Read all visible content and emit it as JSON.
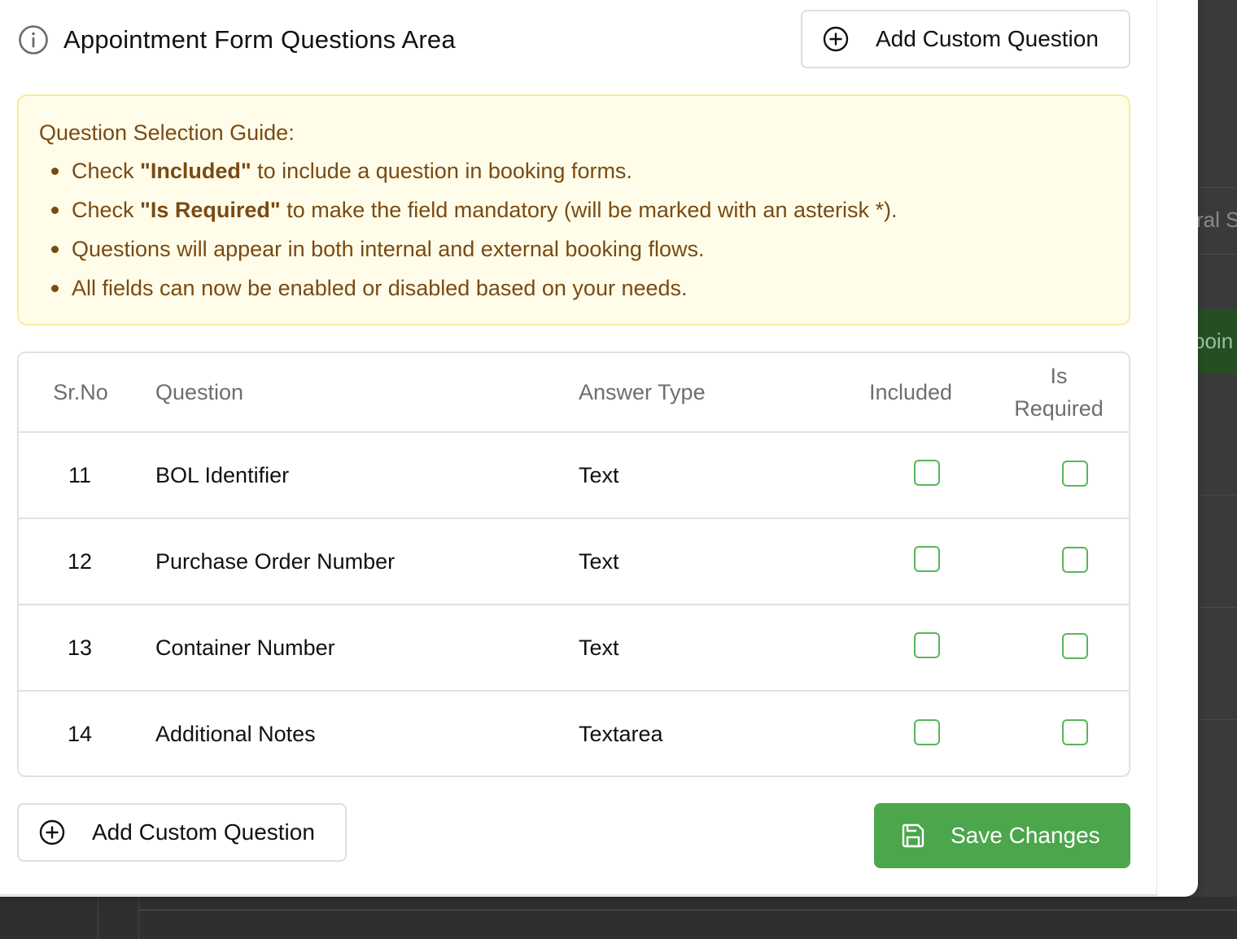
{
  "header": {
    "title": "Appointment Form Questions Area",
    "add_button_label": "Add Custom Question"
  },
  "guide": {
    "title": "Question Selection Guide:",
    "items": [
      {
        "prefix": "Check ",
        "bold": "\"Included\"",
        "suffix": " to include a question in booking forms."
      },
      {
        "prefix": "Check ",
        "bold": "\"Is Required\"",
        "suffix": " to make the field mandatory (will be marked with an asterisk *)."
      },
      {
        "prefix": "Questions will appear in both internal and external booking flows.",
        "bold": "",
        "suffix": ""
      },
      {
        "prefix": "All fields can now be enabled or disabled based on your needs.",
        "bold": "",
        "suffix": ""
      }
    ]
  },
  "table": {
    "columns": {
      "sr": "Sr.No",
      "question": "Question",
      "type": "Answer Type",
      "included": "Included",
      "required_line1": "Is",
      "required_line2": "Required"
    },
    "rows": [
      {
        "sr": "11",
        "question": "BOL Identifier",
        "type": "Text",
        "included": false,
        "required": false
      },
      {
        "sr": "12",
        "question": "Purchase Order Number",
        "type": "Text",
        "included": false,
        "required": false
      },
      {
        "sr": "13",
        "question": "Container Number",
        "type": "Text",
        "included": false,
        "required": false
      },
      {
        "sr": "14",
        "question": "Additional Notes",
        "type": "Textarea",
        "included": false,
        "required": false
      }
    ]
  },
  "footer": {
    "add_button_label": "Add Custom Question",
    "save_button_label": "Save Changes"
  },
  "background": {
    "text1": "ral S",
    "text2": "poin"
  },
  "colors": {
    "accent_green": "#4ca64c",
    "guide_bg": "#fffdea",
    "guide_text": "#7a4a12"
  }
}
